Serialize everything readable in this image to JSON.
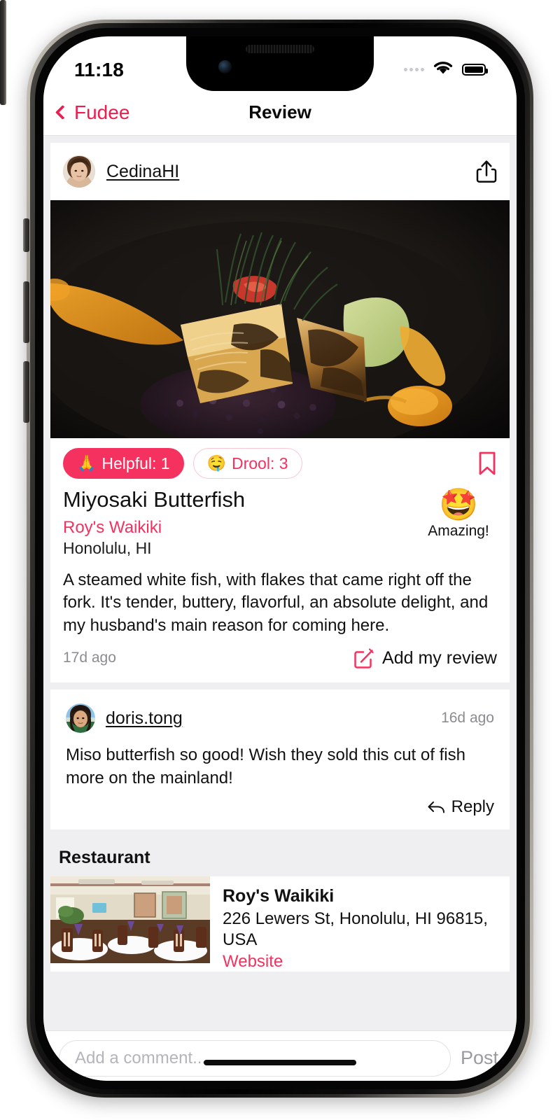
{
  "device": {
    "frame": "iphone"
  },
  "status_bar": {
    "time": "11:18",
    "signal_icon": "signal-dots-icon",
    "wifi_icon": "wifi-icon",
    "battery_icon": "battery-icon"
  },
  "nav": {
    "back_icon": "chevron-left-icon",
    "back_label": "Fudee",
    "title": "Review"
  },
  "post": {
    "author": "CedinaHI",
    "author_avatar": "avatar-cedinahi",
    "share_icon": "share-icon",
    "photo_alt": "miyosaki-butterfish-photo",
    "reactions": [
      {
        "name": "helpful",
        "emoji": "🙏",
        "label": "Helpful: 1",
        "active": true
      },
      {
        "name": "drool",
        "emoji": "🤤",
        "label": "Drool: 3",
        "active": false
      }
    ],
    "bookmark_icon": "bookmark-icon",
    "dish_title": "Miyosaki Butterfish",
    "restaurant_name": "Roy's Waikiki",
    "city": "Honolulu, HI",
    "rating_emoji": "🤩",
    "rating_label": "Amazing!",
    "review_text": "A steamed white fish, with flakes that came right off the fork. It's tender, buttery, flavorful, an absolute delight, and my husband's main reason for coming here.",
    "timestamp": "17d ago",
    "add_review_icon": "edit-square-icon",
    "add_review_label": "Add my review"
  },
  "comments": [
    {
      "author": "doris.tong",
      "avatar": "avatar-doristong",
      "timestamp": "16d ago",
      "text": "Miso butterfish so good!  Wish they sold this cut of fish more on the mainland!",
      "reply_icon": "reply-arrow-icon",
      "reply_label": "Reply"
    }
  ],
  "restaurant_section": {
    "heading": "Restaurant",
    "thumb_alt": "roys-waikiki-dining-room",
    "name": "Roy's Waikiki",
    "address": "226 Lewers St, Honolulu, HI 96815, USA",
    "website_label": "Website"
  },
  "composer": {
    "placeholder": "Add a comment...",
    "value": "",
    "post_label": "Post"
  },
  "colors": {
    "accent": "#f5325f",
    "accent_nav": "#ef1d4e",
    "page_bg": "#efeff1",
    "card_bg": "#ffffff",
    "muted_text": "#8b8b90"
  }
}
